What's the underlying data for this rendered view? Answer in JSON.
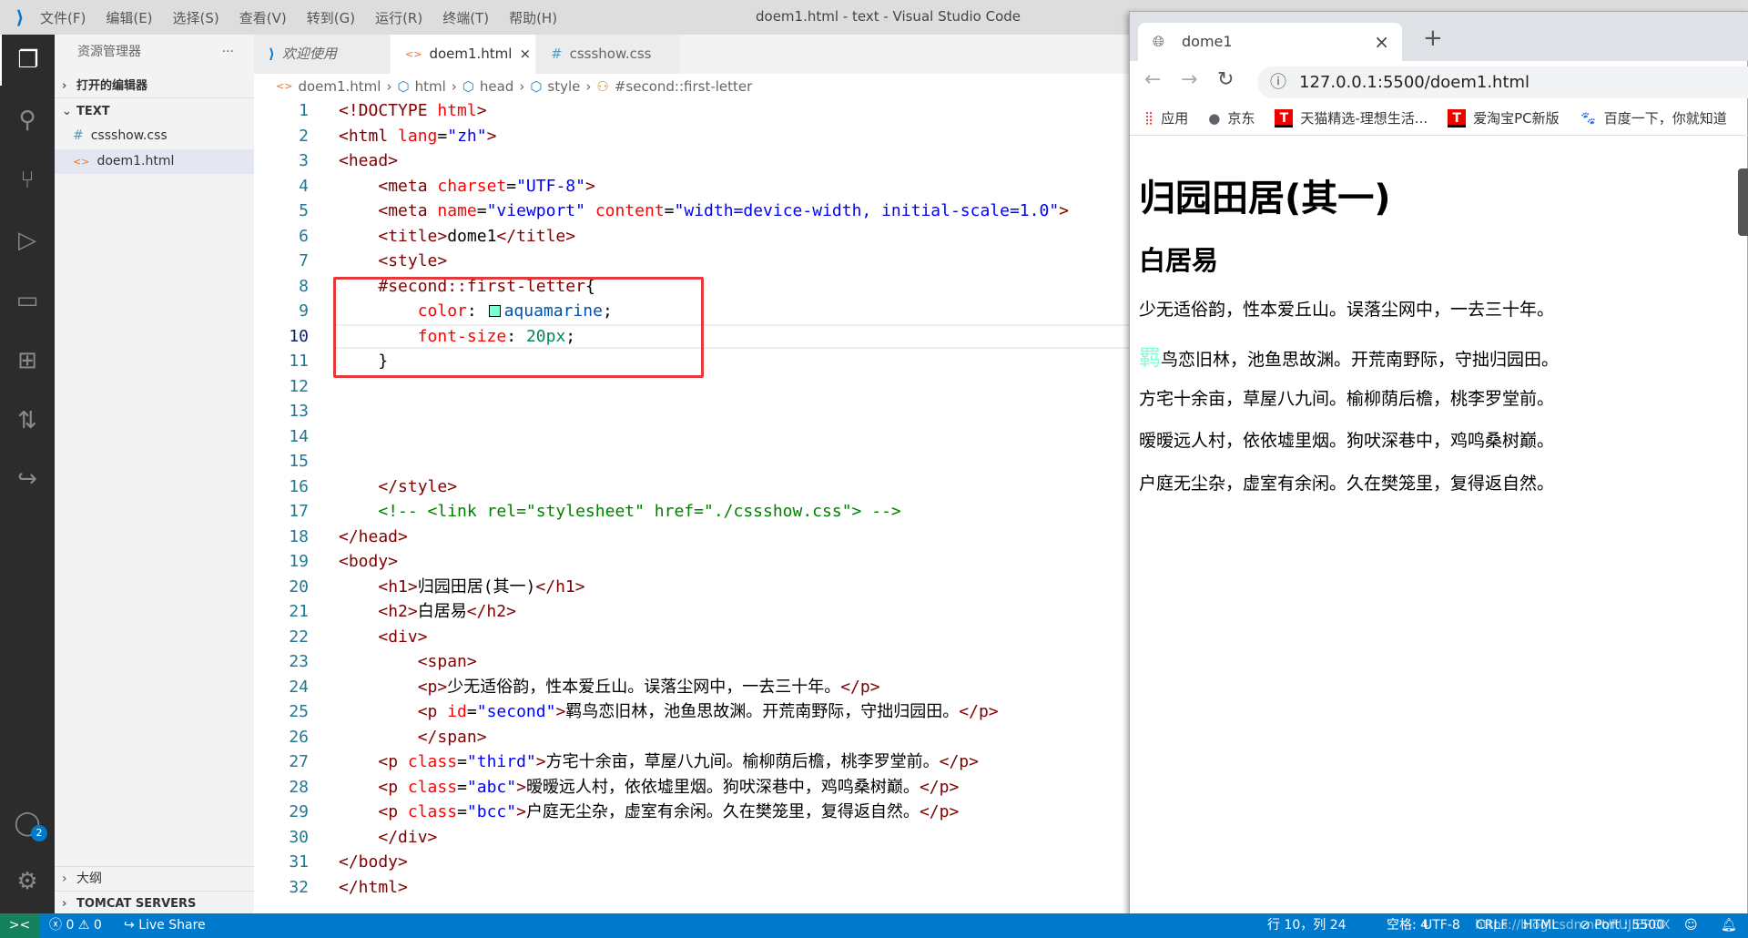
{
  "titlebar": {
    "menus": [
      "文件(F)",
      "编辑(E)",
      "选择(S)",
      "查看(V)",
      "转到(G)",
      "运行(R)",
      "终端(T)",
      "帮助(H)"
    ],
    "title": "doem1.html - text - Visual Studio Code"
  },
  "sidebar": {
    "title": "资源管理器",
    "more": "···",
    "open_editors": "打开的编辑器",
    "folder": "TEXT",
    "files": [
      {
        "name": "cssshow.css",
        "icon": "#"
      },
      {
        "name": "doem1.html",
        "icon": "<>"
      }
    ],
    "outline": "大纲",
    "tomcat": "TOMCAT SERVERS",
    "accounts_badge": "2"
  },
  "tabs": [
    {
      "label": "欢迎使用"
    },
    {
      "label": "doem1.html",
      "close": "×"
    },
    {
      "label": "cssshow.css"
    }
  ],
  "breadcrumb": [
    "doem1.html",
    "html",
    "head",
    "style",
    "#second::first-letter"
  ],
  "code": {
    "current_line": 10,
    "swatch_color": "#7fffd4",
    "lines": [
      [
        [
          "tag",
          "<!DOCTYPE "
        ],
        [
          "attr",
          "html"
        ],
        [
          "tag",
          ">"
        ]
      ],
      [
        [
          "tag",
          "<html "
        ],
        [
          "attr",
          "lang"
        ],
        [
          "pun",
          "="
        ],
        [
          "str",
          "\"zh\""
        ],
        [
          "tag",
          ">"
        ]
      ],
      [
        [
          "tag",
          "<head>"
        ]
      ],
      [
        [
          "txt",
          "    "
        ],
        [
          "tag",
          "<meta "
        ],
        [
          "attr",
          "charset"
        ],
        [
          "pun",
          "="
        ],
        [
          "str",
          "\"UTF-8\""
        ],
        [
          "tag",
          ">"
        ]
      ],
      [
        [
          "txt",
          "    "
        ],
        [
          "tag",
          "<meta "
        ],
        [
          "attr",
          "name"
        ],
        [
          "pun",
          "="
        ],
        [
          "str",
          "\"viewport\""
        ],
        [
          "txt",
          " "
        ],
        [
          "attr",
          "content"
        ],
        [
          "pun",
          "="
        ],
        [
          "str",
          "\"width=device-width, initial-scale=1.0\""
        ],
        [
          "tag",
          ">"
        ]
      ],
      [
        [
          "txt",
          "    "
        ],
        [
          "tag",
          "<title>"
        ],
        [
          "txt",
          "dome1"
        ],
        [
          "tag",
          "</title>"
        ]
      ],
      [
        [
          "txt",
          "    "
        ],
        [
          "tag",
          "<style>"
        ]
      ],
      [
        [
          "txt",
          "    "
        ],
        [
          "sel",
          "#second::first-letter"
        ],
        [
          "pun",
          "{"
        ]
      ],
      [
        [
          "txt",
          "        "
        ],
        [
          "prop",
          "color"
        ],
        [
          "pun",
          ": "
        ],
        [
          "swatch",
          ""
        ],
        [
          "val",
          "aquamarine"
        ],
        [
          "pun",
          ";"
        ]
      ],
      [
        [
          "txt",
          "        "
        ],
        [
          "prop",
          "font-size"
        ],
        [
          "pun",
          ": "
        ],
        [
          "num",
          "20px"
        ],
        [
          "pun",
          ";"
        ]
      ],
      [
        [
          "txt",
          "    "
        ],
        [
          "pun",
          "}"
        ]
      ],
      [],
      [],
      [],
      [],
      [
        [
          "txt",
          "    "
        ],
        [
          "tag",
          "</style>"
        ]
      ],
      [
        [
          "txt",
          "    "
        ],
        [
          "com",
          "<!-- <link rel=\"stylesheet\" href=\"./cssshow.css\"> -->"
        ]
      ],
      [
        [
          "tag",
          "</head>"
        ]
      ],
      [
        [
          "tag",
          "<body>"
        ]
      ],
      [
        [
          "txt",
          "    "
        ],
        [
          "tag",
          "<h1>"
        ],
        [
          "txt",
          "归园田居(其一)"
        ],
        [
          "tag",
          "</h1>"
        ]
      ],
      [
        [
          "txt",
          "    "
        ],
        [
          "tag",
          "<h2>"
        ],
        [
          "txt",
          "白居易"
        ],
        [
          "tag",
          "</h2>"
        ]
      ],
      [
        [
          "txt",
          "    "
        ],
        [
          "tag",
          "<div>"
        ]
      ],
      [
        [
          "txt",
          "        "
        ],
        [
          "tag",
          "<span>"
        ]
      ],
      [
        [
          "txt",
          "        "
        ],
        [
          "tag",
          "<p>"
        ],
        [
          "txt",
          "少无适俗韵，性本爱丘山。误落尘网中，一去三十年。"
        ],
        [
          "tag",
          "</p>"
        ]
      ],
      [
        [
          "txt",
          "        "
        ],
        [
          "tag",
          "<p "
        ],
        [
          "attr",
          "id"
        ],
        [
          "pun",
          "="
        ],
        [
          "str",
          "\"second\""
        ],
        [
          "tag",
          ">"
        ],
        [
          "txt",
          "羁鸟恋旧林，池鱼思故渊。开荒南野际，守拙归园田。"
        ],
        [
          "tag",
          "</p>"
        ]
      ],
      [
        [
          "txt",
          "        "
        ],
        [
          "tag",
          "</span>"
        ]
      ],
      [
        [
          "txt",
          "    "
        ],
        [
          "tag",
          "<p "
        ],
        [
          "attr",
          "class"
        ],
        [
          "pun",
          "="
        ],
        [
          "str",
          "\"third\""
        ],
        [
          "tag",
          ">"
        ],
        [
          "txt",
          "方宅十余亩，草屋八九间。榆柳荫后檐，桃李罗堂前。"
        ],
        [
          "tag",
          "</p>"
        ]
      ],
      [
        [
          "txt",
          "    "
        ],
        [
          "tag",
          "<p "
        ],
        [
          "attr",
          "class"
        ],
        [
          "pun",
          "="
        ],
        [
          "str",
          "\"abc\""
        ],
        [
          "tag",
          ">"
        ],
        [
          "txt",
          "暧暧远人村，依依墟里烟。狗吠深巷中，鸡鸣桑树巅。"
        ],
        [
          "tag",
          "</p>"
        ]
      ],
      [
        [
          "txt",
          "    "
        ],
        [
          "tag",
          "<p "
        ],
        [
          "attr",
          "class"
        ],
        [
          "pun",
          "="
        ],
        [
          "str",
          "\"bcc\""
        ],
        [
          "tag",
          ">"
        ],
        [
          "txt",
          "户庭无尘杂，虚室有余闲。久在樊笼里，复得返自然。"
        ],
        [
          "tag",
          "</p>"
        ]
      ],
      [
        [
          "txt",
          "    "
        ],
        [
          "tag",
          "</div>"
        ]
      ],
      [
        [
          "tag",
          "</body>"
        ]
      ],
      [
        [
          "tag",
          "</html>"
        ]
      ]
    ]
  },
  "status": {
    "remote": "><",
    "errors": "0",
    "warnings": "0",
    "live_share": "Live Share",
    "position": "行 10，列 24",
    "spaces": "空格: 4",
    "encoding": "UTF-8",
    "eol": "CRLF",
    "language": "HTML",
    "port": "Port : 5500",
    "watermark": "https://blog.csdn.net/FUJIEROX"
  },
  "browser": {
    "tab_title": "dome1",
    "tab_close": "×",
    "new_tab": "+",
    "url": "127.0.0.1:5500/doem1.html",
    "bookmarks": [
      "应用",
      "京东",
      "天猫精选-理想生活...",
      "爱淘宝PC新版",
      "百度一下，你就知道"
    ],
    "page": {
      "h1": "归园田居(其一)",
      "h2": "白居易",
      "first_letter_color": "#7fffd4",
      "paragraphs": [
        "少无适俗韵，性本爱丘山。误落尘网中，一去三十年。",
        "羁鸟恋旧林，池鱼思故渊。开荒南野际，守拙归园田。",
        "方宅十余亩，草屋八九间。榆柳荫后檐，桃李罗堂前。",
        "暧暧远人村，依依墟里烟。狗吠深巷中，鸡鸣桑树巅。",
        "户庭无尘杂，虚室有余闲。久在樊笼里，复得返自然。"
      ]
    }
  }
}
